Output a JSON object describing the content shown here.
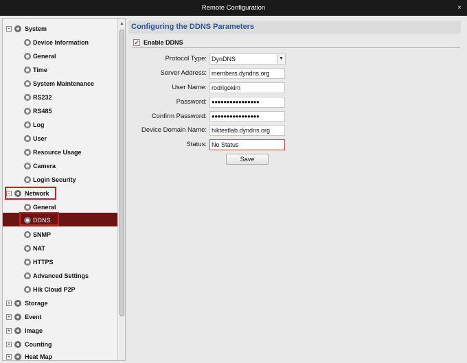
{
  "window": {
    "title": "Remote Configuration",
    "close": "×"
  },
  "tree": {
    "system": "System",
    "system_items": [
      "Device Information",
      "General",
      "Time",
      "System Maintenance",
      "RS232",
      "RS485",
      "Log",
      "User",
      "Resource Usage",
      "Camera",
      "Login Security"
    ],
    "network": "Network",
    "network_items": [
      "General",
      "DDNS",
      "SNMP",
      "NAT",
      "HTTPS",
      "Advanced Settings",
      "Hik Cloud P2P"
    ],
    "others": [
      "Storage",
      "Event",
      "Image",
      "Counting",
      "Heat Map"
    ],
    "selected": "DDNS"
  },
  "content": {
    "title": "Configuring the DDNS Parameters",
    "enable_label": "Enable DDNS",
    "enable_checked": true,
    "fields": {
      "protocol_type": {
        "label": "Protocol Type:",
        "value": "DynDNS"
      },
      "server_address": {
        "label": "Server Address:",
        "value": "members.dyndns.org"
      },
      "user_name": {
        "label": "User Name:",
        "value": "rodrigokim"
      },
      "password": {
        "label": "Password:",
        "value": "●●●●●●●●●●●●●●●●"
      },
      "confirm_password": {
        "label": "Confirm Password:",
        "value": "●●●●●●●●●●●●●●●●"
      },
      "device_domain_name": {
        "label": "Device Domain Name:",
        "value": "hiktestlab.dyndns.org"
      },
      "status": {
        "label": "Status:",
        "value": "No Status"
      }
    },
    "save_label": "Save"
  },
  "colors": {
    "accent": "#2b5591",
    "selected_bg": "#6b1414",
    "highlight": "#d61a1f"
  }
}
